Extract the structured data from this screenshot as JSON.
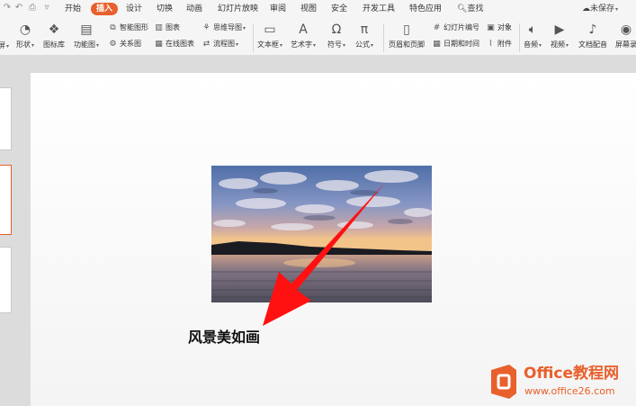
{
  "menubar": {
    "tabs": [
      {
        "label": "开始"
      },
      {
        "label": "插入"
      },
      {
        "label": "设计"
      },
      {
        "label": "切换"
      },
      {
        "label": "动画"
      },
      {
        "label": "幻灯片放映"
      },
      {
        "label": "审阅"
      },
      {
        "label": "视图"
      },
      {
        "label": "安全"
      },
      {
        "label": "开发工具"
      },
      {
        "label": "特色应用"
      }
    ],
    "active_tab": "插入",
    "search_label": "查找",
    "unsaved_label": "未保存",
    "accent_color": "#e8602c"
  },
  "ribbon": {
    "shape": "形状",
    "icon_lib": "图标库",
    "function_chart": "功能图",
    "smart_shape": "智能图形",
    "relation_chart": "关系图",
    "chart": "图表",
    "online_chart": "在线图表",
    "mind_map": "思维导图",
    "flow_chart": "流程图",
    "textbox": "文本框",
    "art_text": "艺术字",
    "symbol": "符号",
    "formula": "公式",
    "header_footer": "页眉和页脚",
    "slide_number": "幻灯片编号",
    "date_time": "日期和时间",
    "object": "对象",
    "attachment": "附件",
    "audio": "音频",
    "video": "视频",
    "doc_dub": "文档配音",
    "screen_rec": "屏幕录"
  },
  "slide": {
    "caption": "风景美如画",
    "photo_description_colors": {
      "sky_top": "#5a7fb8",
      "sky_mid": "#8a9cc8",
      "horizon": "#f2c48a",
      "water": "#6a6470"
    },
    "arrow_color": "#ff1111"
  },
  "watermark": {
    "title": "Office教程网",
    "url": "www.office26.com"
  }
}
